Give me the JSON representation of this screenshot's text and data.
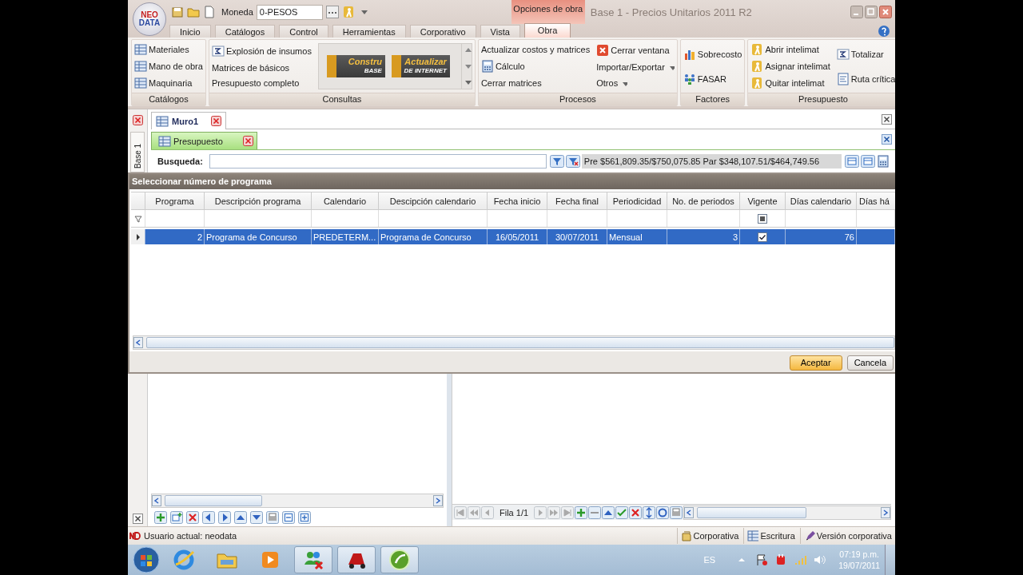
{
  "logo": {
    "line1": "NEO",
    "line2": "DATA"
  },
  "title_bar": {
    "currency_label": "Moneda",
    "currency_value": "0-PESOS",
    "context_tab": "Opciones de obra",
    "title": "Base 1 - Precios Unitarios 2011 R2"
  },
  "ribbon_tabs": [
    {
      "label": "Inicio",
      "selected": false
    },
    {
      "label": "Catálogos",
      "selected": false
    },
    {
      "label": "Control",
      "selected": false
    },
    {
      "label": "Herramientas",
      "selected": false
    },
    {
      "label": "Corporativo",
      "selected": false
    },
    {
      "label": "Vista",
      "selected": false
    },
    {
      "label": "Obra",
      "selected": true
    }
  ],
  "ribbon_groups": [
    {
      "label": "Catálogos",
      "columns": [
        [
          {
            "label": "Materiales",
            "kind": "grid"
          },
          {
            "label": "Mano de obra",
            "kind": "grid"
          },
          {
            "label": "Maquinaria",
            "kind": "grid"
          }
        ]
      ]
    },
    {
      "label": "Consultas",
      "columns": [
        [
          {
            "label": "Explosión de insumos",
            "kind": "sum"
          },
          {
            "label": "Matrices de básicos",
            "kind": "plain"
          },
          {
            "label": "Presupuesto completo",
            "kind": "plain"
          }
        ]
      ],
      "gallery": [
        {
          "line1": "Constru",
          "line2": "BASE"
        },
        {
          "line1": "Actualizar",
          "line2": "DE INTERNET"
        }
      ]
    },
    {
      "label": "Procesos",
      "columns": [
        [
          {
            "label": "Actualizar costos y matrices",
            "kind": "plain"
          },
          {
            "label": "Cálculo",
            "kind": "calc"
          },
          {
            "label": "Cerrar matrices",
            "kind": "plain"
          }
        ],
        [
          {
            "label": "Cerrar ventana",
            "kind": "close"
          },
          {
            "label": "Importar/Exportar",
            "kind": "plain",
            "dropdown": true
          },
          {
            "label": "Otros",
            "kind": "plain",
            "dropdown": true
          }
        ]
      ]
    },
    {
      "label": "Factores",
      "columns": [
        [
          {
            "label": "Sobrecosto",
            "kind": "chart"
          },
          {
            "label": "FASAR",
            "kind": "people"
          }
        ]
      ]
    },
    {
      "label": "Presupuesto",
      "columns": [
        [
          {
            "label": "Abrir intelimat",
            "kind": "person"
          },
          {
            "label": "Asignar intelimat",
            "kind": "person"
          },
          {
            "label": "Quitar intelimat",
            "kind": "person"
          }
        ],
        [
          {
            "label": "Totalizar",
            "kind": "sum"
          },
          {
            "label": "Ruta crítica",
            "kind": "doc"
          }
        ]
      ]
    }
  ],
  "side_tab": "Base 1",
  "document_tab": "Muro1",
  "sub_tab": "Presupuesto",
  "search": {
    "label": "Busqueda:"
  },
  "totals": "Pre $561,809.35/$750,075.85 Par $348,107.51/$464,749.56",
  "dialog": {
    "title": "Seleccionar número de programa",
    "columns": [
      "Programa",
      "Descripción programa",
      "Calendario",
      "Descipción calendario",
      "Fecha inicio",
      "Fecha final",
      "Periodicidad",
      "No. de periodos",
      "Vigente",
      "Días calendario",
      "Días há"
    ],
    "vigente_filter": {
      "kind": "indeterminate"
    },
    "rows": [
      {
        "selected": true,
        "vigente": true,
        "cells": [
          "2",
          "Programa de Concurso",
          "PREDETERM...",
          "Programa de Concurso",
          "16/05/2011",
          "30/07/2011",
          "Mensual",
          "3",
          "",
          "76",
          ""
        ]
      }
    ],
    "buttons": [
      {
        "label": "Aceptar",
        "default": true
      },
      {
        "label": "Cancela",
        "default": false
      }
    ]
  },
  "pager": "Fila 1/1",
  "status_bar": {
    "user": "Usuario actual: neodata",
    "items": [
      "Corporativa",
      "Escritura",
      "Versión corporativa"
    ]
  },
  "taskbar": {
    "language": "ES",
    "time": "07:19 p.m.",
    "date": "19/07/2011"
  }
}
